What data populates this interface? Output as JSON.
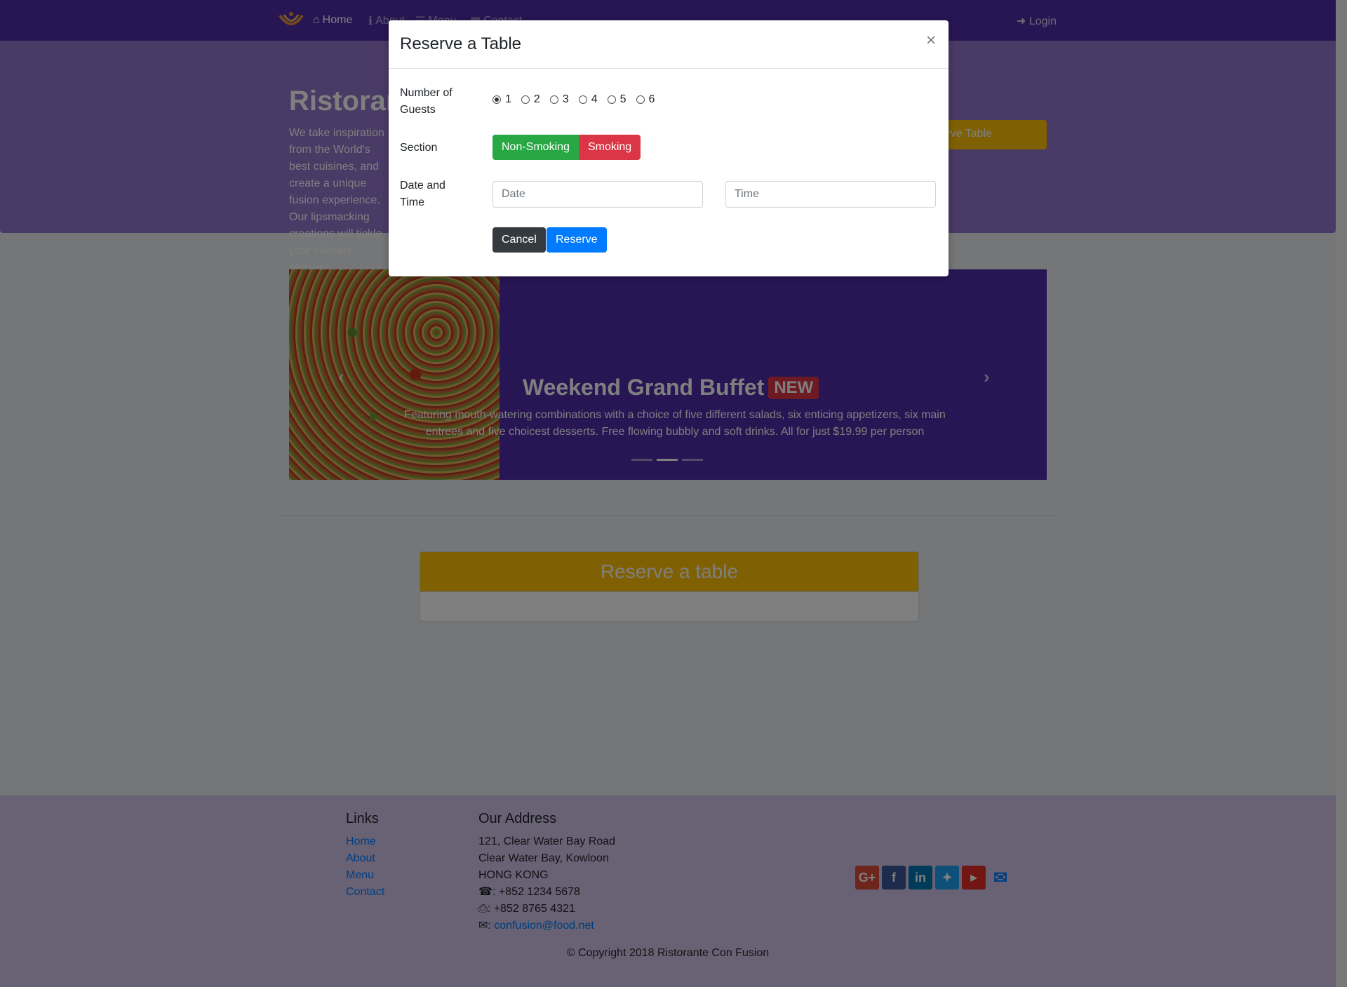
{
  "navbar": {
    "home": "Home",
    "about": "About",
    "menu": "Menu",
    "contact": "Contact",
    "login": "Login"
  },
  "jumbotron": {
    "title": "Ristorante con Fusion",
    "text": "We take inspiration from the World's best cuisines, and create a unique fusion experience. Our lipsmacking creations will tickle your culinary senses!",
    "button": "Reserve Table"
  },
  "carousel": {
    "title": "Weekend Grand Buffet",
    "badge": "NEW",
    "text": "Featuring mouth-watering combinations with a choice of five different salads, six enticing appetizers, six main entrees and five choicest desserts. Free flowing bubbly and soft drinks. All for just $19.99 per person",
    "slide_count": 3,
    "active_slide": 2
  },
  "reserve_card": {
    "title": "Reserve a table"
  },
  "footer": {
    "links_heading": "Links",
    "links": [
      "Home",
      "About",
      "Menu",
      "Contact"
    ],
    "address_heading": "Our Address",
    "address_lines": [
      "121, Clear Water Bay Road",
      "Clear Water Bay, Kowloon",
      "HONG KONG"
    ],
    "phone": ": +852 1234 5678",
    "fax": ": +852 8765 4321",
    "email": "confusion@food.net",
    "copyright": "© Copyright 2018 Ristorante Con Fusion",
    "social_icons": [
      "google-plus-icon",
      "facebook-icon",
      "linkedin-icon",
      "twitter-icon",
      "youtube-icon",
      "mail-icon"
    ]
  },
  "modal": {
    "title": "Reserve a Table",
    "close": "×",
    "guests_label": "Number of Guests",
    "guest_options": [
      "1",
      "2",
      "3",
      "4",
      "5",
      "6"
    ],
    "guest_selected": "1",
    "section_label": "Section",
    "section_options": [
      "Non-Smoking",
      "Smoking"
    ],
    "datetime_label": "Date and Time",
    "date_placeholder": "Date",
    "time_placeholder": "Time",
    "cancel": "Cancel",
    "reserve": "Reserve"
  },
  "colors": {
    "primary": "#512da8",
    "jumbotron": "#9575cd",
    "footer": "#d1c4e9",
    "warning": "#ffc107",
    "success": "#28a745",
    "danger": "#dc3545",
    "link": "#007bff"
  }
}
